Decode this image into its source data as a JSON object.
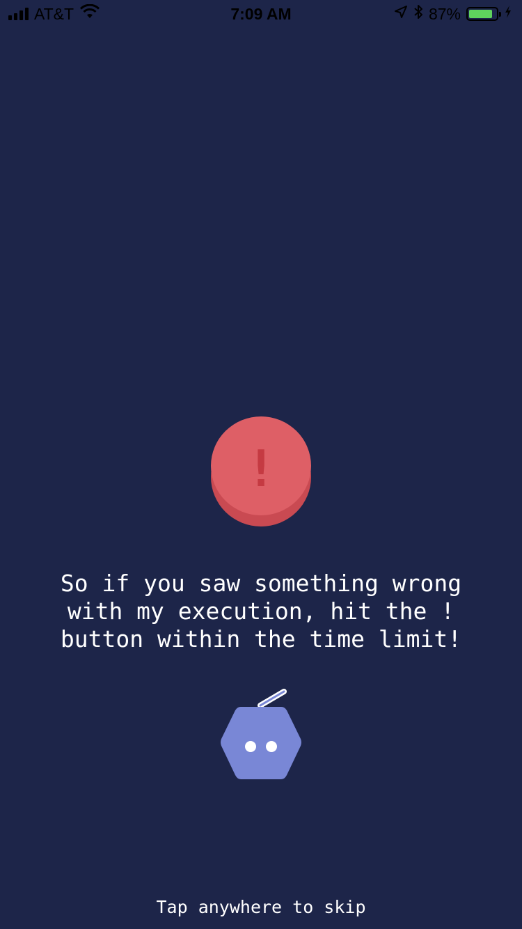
{
  "status_bar": {
    "carrier": "AT&T",
    "time": "7:09 AM",
    "battery_percent": "87%",
    "battery_level": 0.87,
    "icons": [
      "signal-icon",
      "wifi-icon",
      "location-icon",
      "bluetooth-icon",
      "battery-icon",
      "charging-icon"
    ]
  },
  "alert": {
    "symbol": "!",
    "colors": {
      "top": "#de5f66",
      "base": "#c94a52",
      "mark": "#c53a42"
    }
  },
  "message": {
    "text": "So if you saw something wrong\nwith my execution, hit the !\nbutton within the time limit!"
  },
  "robot": {
    "icon": "robot-icon",
    "color": "#7987d6"
  },
  "skip": {
    "text": "Tap anywhere to skip"
  },
  "theme": {
    "background": "#1d2549",
    "text": "#ffffff"
  }
}
